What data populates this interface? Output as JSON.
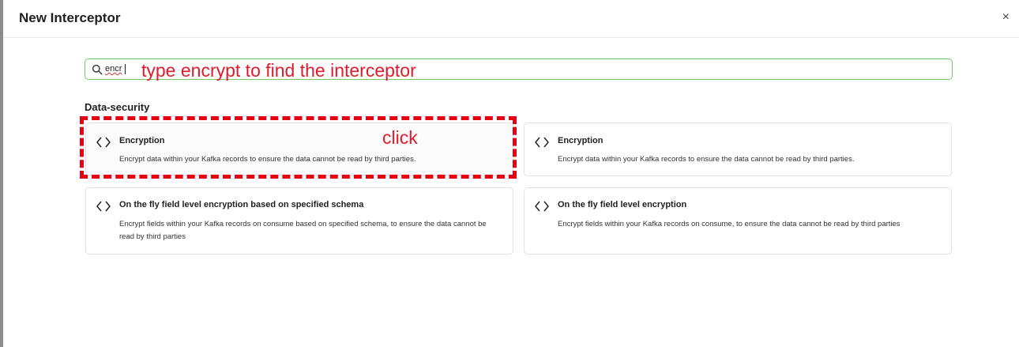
{
  "dialog": {
    "title": "New Interceptor",
    "close_label": "×"
  },
  "search": {
    "value": "encr"
  },
  "annotations": {
    "search_hint": "type encrypt to find the interceptor",
    "click_hint": "click"
  },
  "section": {
    "title": "Data-security",
    "cards": [
      {
        "title": "Encryption",
        "description": "Encrypt data within your Kafka records to ensure the data cannot be read by third parties."
      },
      {
        "title": "Encryption",
        "description": "Encrypt data within your Kafka records to ensure the data cannot be read by third parties."
      },
      {
        "title": "On the fly field level encryption based on specified schema",
        "description": "Encrypt fields within your Kafka records on consume based on specified schema, to ensure the data cannot be read by third parties"
      },
      {
        "title": "On the fly field level encryption",
        "description": "Encrypt fields within your Kafka records on consume, to ensure the data cannot be read by third parties"
      }
    ]
  },
  "icons": {
    "search": "search-icon",
    "card": "code-brackets-icon",
    "close": "close-icon"
  },
  "colors": {
    "annotation": "#e01b2e",
    "search_border": "#7ac46a",
    "dashed_highlight": "#e60012"
  }
}
